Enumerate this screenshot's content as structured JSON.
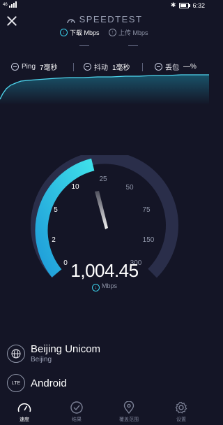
{
  "status_bar": {
    "signal": "46",
    "time": "6:32"
  },
  "header": {
    "title": "SPEEDTEST",
    "tabs": [
      {
        "label": "下载 Mbps",
        "icon": "download-icon",
        "active": true
      },
      {
        "label": "上传 Mbps",
        "icon": "upload-icon",
        "active": false
      }
    ]
  },
  "metrics": {
    "ping": {
      "label": "Ping",
      "value": "7毫秒"
    },
    "jitter": {
      "label": "抖动",
      "value": "1毫秒"
    },
    "loss": {
      "label": "丢包",
      "value": "—%"
    }
  },
  "gauge": {
    "tick_labels": [
      "0",
      "2",
      "5",
      "10",
      "25",
      "50",
      "75",
      "150",
      "300"
    ],
    "current_speed": "1,004.45",
    "unit": "Mbps",
    "colors": {
      "accent": "#22c5e6",
      "track": "#2a2e4a"
    }
  },
  "provider": {
    "name": "Beijing Unicom",
    "city": "Beijing"
  },
  "connection": {
    "badge": "LTE",
    "device": "Android"
  },
  "nav": [
    {
      "label": "速度",
      "icon": "speedometer-icon",
      "active": true
    },
    {
      "label": "结果",
      "icon": "check-circle-icon",
      "active": false
    },
    {
      "label": "覆盖范围",
      "icon": "map-pin-icon",
      "active": false
    },
    {
      "label": "设置",
      "icon": "gear-icon",
      "active": false
    }
  ]
}
